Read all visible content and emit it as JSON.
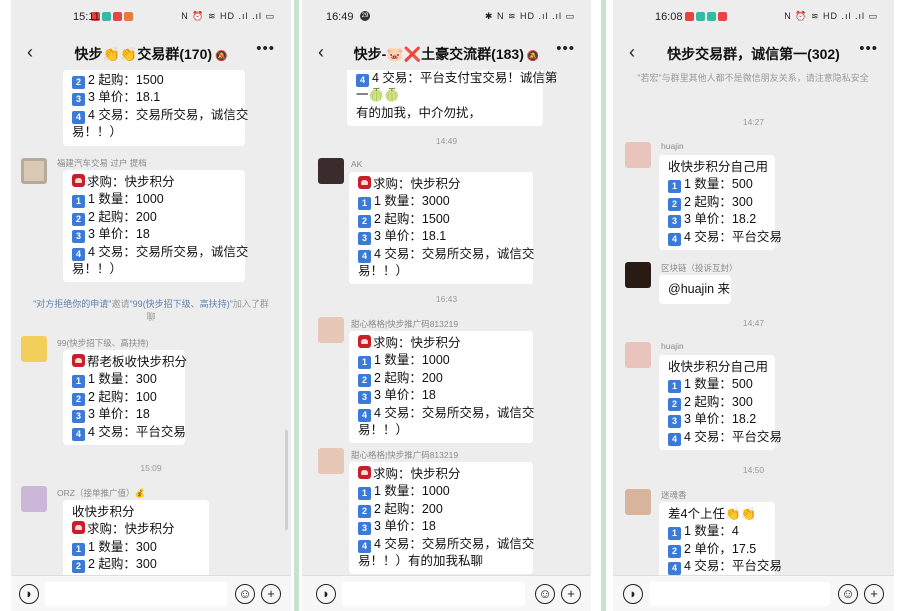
{
  "panels": [
    {
      "status_time": "15:11",
      "status_icons": "N ⏰ ≋ HD .ıl .ıl ▭",
      "title": "快步👏👏交易群(170)",
      "messages": {
        "m1": {
          "lines": [
            "2 起购：1500",
            "3 单价：18.1",
            "4 交易：交易所交易，诚信交",
            "易！！）"
          ]
        },
        "m2": {
          "sender": "福建汽车交易 过户 提档",
          "lines": [
            "求购：快步积分",
            "1 数量：1000",
            "2 起购：200",
            "3 单价：18",
            "4 交易：交易所交易，诚信交",
            "易！！）"
          ]
        },
        "sys": {
          "part1": "\"对方拒绝你的申请\"",
          "part2": "邀请",
          "part3": "\"99(快步招下级、高扶持)\"",
          "part4": "加入了群聊"
        },
        "m3": {
          "sender": "99(快步招下级、高扶持)",
          "lines": [
            "帮老板收快步积分",
            "1 数量：300",
            "2 起购：100",
            "3 单价：18",
            "4 交易：平台交易"
          ]
        },
        "ts": "15:09",
        "m4": {
          "sender": "ORZ（接单推广值）💰",
          "lines": [
            "收快步积分",
            "求购：快步积分",
            "1 数量：300",
            "2 起购：300"
          ]
        }
      }
    },
    {
      "status_time": "16:49",
      "status_icons": "✱ N ≋ HD .ıl .ıl ▭",
      "title": "快步-🐷❌土豪交流群(183)",
      "messages": {
        "m1": {
          "lines": [
            "4 交易：平台支付宝交易！诚信第",
            "一🍈🍈",
            "有的加我，中介勿扰，"
          ]
        },
        "ts1": "14:49",
        "m2": {
          "sender": "AK",
          "lines": [
            "求购：快步积分",
            "1 数量：3000",
            "2 起购：1500",
            "3 单价：18.1",
            "4 交易：交易所交易，诚信交",
            "易！！）"
          ]
        },
        "ts2": "16:43",
        "m3": {
          "sender": "甜心格格|快步推广码813219",
          "lines": [
            "求购：快步积分",
            "1 数量：1000",
            "2 起购：200",
            "3 单价：18",
            "4 交易：交易所交易，诚信交",
            "易！！）"
          ]
        },
        "m4": {
          "sender": "甜心格格|快步推广码813219",
          "lines": [
            "求购：快步积分",
            "1 数量：1000",
            "2 起购：200",
            "3 单价：18",
            "4 交易：交易所交易，诚信交",
            "易！！）有的加我私聊"
          ]
        }
      }
    },
    {
      "status_time": "16:08",
      "status_icons": "N ⏰ ≋ HD .ıl .ıl ▭",
      "title": "快步交易群，诚信第一(302)",
      "messages": {
        "sys": {
          "part1": "\"若宏\"与群里其他人都不是微信朋友关系，请注意隐私安全"
        },
        "ts1": "14:27",
        "m1": {
          "sender": "huajin",
          "lines": [
            "收快步积分自己用",
            "1 数量：500",
            "2 起购：300",
            "3 单价：18.2",
            "4 交易：平台交易"
          ]
        },
        "m2": {
          "sender": "区块链（投诉互封）",
          "lines": [
            "@huajin 来"
          ]
        },
        "ts2": "14:47",
        "m3": {
          "sender": "huajin",
          "lines": [
            "收快步积分自己用",
            "1 数量：500",
            "2 起购：300",
            "3 单价：18.2",
            "4 交易：平台交易"
          ]
        },
        "ts3": "14:50",
        "m4": {
          "sender": "迷魂香",
          "lines": [
            "差4个上任👏👏",
            "1 数量：4",
            "2 单价，17.5",
            "4 交易：平台交易"
          ]
        }
      }
    }
  ]
}
